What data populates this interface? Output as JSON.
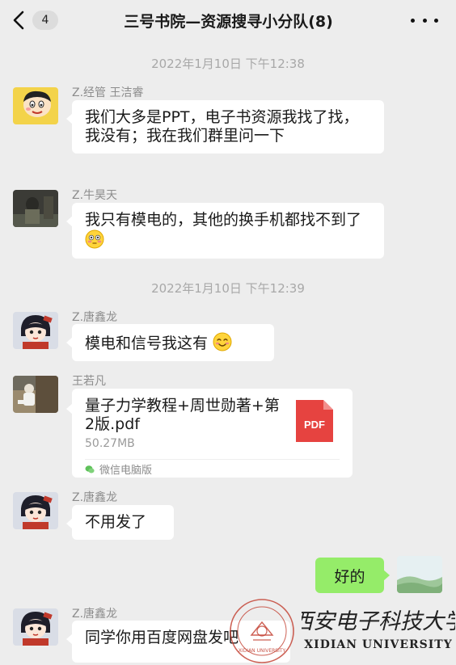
{
  "header": {
    "back_label": "<",
    "unread_count": "4",
    "title": "三号书院—资源搜寻小分队(8)"
  },
  "timestamps": [
    "2022年1月10日 下午12:38",
    "2022年1月10日 下午12:39"
  ],
  "messages": [
    {
      "sender": "Z.经管 王洁睿",
      "text": "我们大多是PPT，电子书资源我找了找，我没有；我在我们群里问一下"
    },
    {
      "sender": "Z.牛昊天",
      "text": "我只有模电的，其他的换手机都找不到了",
      "emoji": "flushed-face"
    },
    {
      "sender": "Z.唐鑫龙",
      "text": "模电和信号我这有",
      "emoji": "smiling-face"
    },
    {
      "sender": "王若凡",
      "file": {
        "name": "量子力学教程+周世勋著+第2版.pdf",
        "size": "50.27MB",
        "icon": "PDF",
        "source": "微信电脑版"
      }
    },
    {
      "sender": "Z.唐鑫龙",
      "text": "不用发了"
    },
    {
      "self": true,
      "text": "好的"
    },
    {
      "sender": "Z.唐鑫龙",
      "text": "同学你用百度网盘发吧"
    }
  ],
  "watermark": {
    "chinese": "西安电子科技大学",
    "english": "XIDIAN UNIVERSITY",
    "seal_text": "XIDIAN UNIVERSITY"
  },
  "colors": {
    "background": "#ededed",
    "bubble_other": "#ffffff",
    "bubble_self": "#95ec69",
    "pdf_red": "#e64340",
    "watermark_red": "#c0392b"
  }
}
